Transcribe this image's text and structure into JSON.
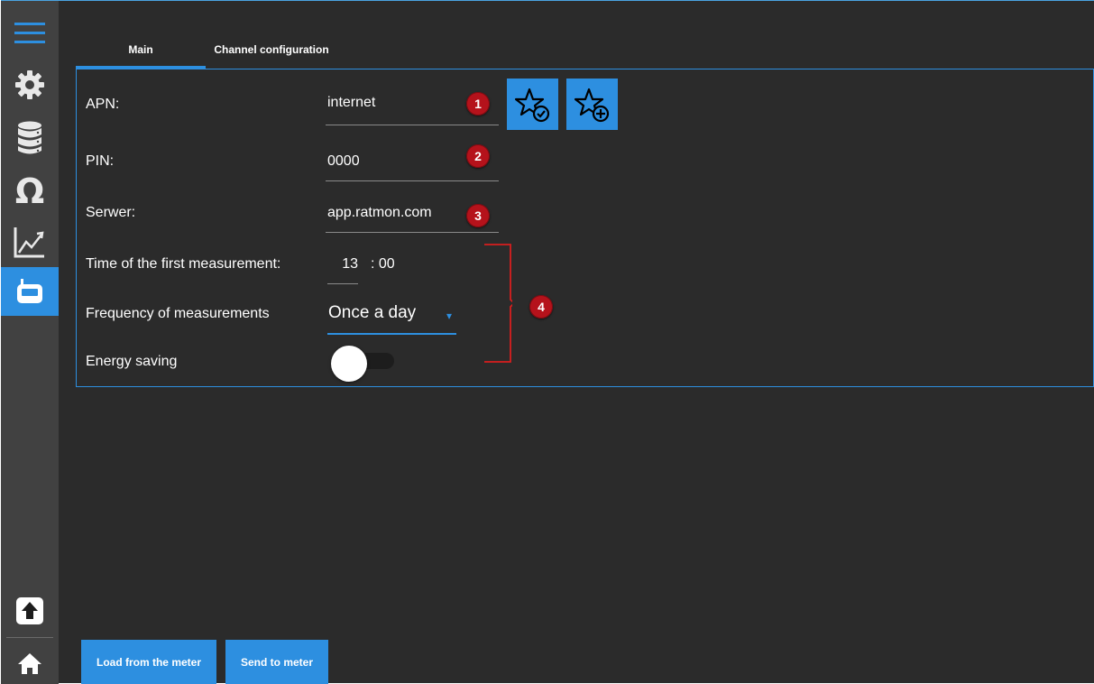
{
  "sidebar": {
    "items": [
      {
        "icon": "hamburger-menu-icon"
      },
      {
        "icon": "gear-icon"
      },
      {
        "icon": "database-icon"
      },
      {
        "icon": "omega-icon"
      },
      {
        "icon": "line-chart-icon"
      },
      {
        "icon": "meter-device-icon",
        "active": true
      },
      {
        "icon": "upload-icon"
      },
      {
        "icon": "home-icon"
      }
    ],
    "accent_color": "#2d8fe0"
  },
  "tabs": [
    {
      "label": "Main",
      "active": true
    },
    {
      "label": "Channel configuration",
      "active": false
    }
  ],
  "form": {
    "apn": {
      "label": "APN:",
      "value": "internet",
      "badge": "1"
    },
    "pin": {
      "label": "PIN:",
      "value": "0000",
      "badge": "2"
    },
    "server": {
      "label": "Serwer:",
      "value": "app.ratmon.com",
      "badge": "3"
    },
    "first_measurement": {
      "label": "Time of the first measurement:",
      "hour": "13",
      "minute": ": 00"
    },
    "frequency": {
      "label": "Frequency of measurements",
      "value": "Once a day",
      "arrow": "▾"
    },
    "energy_saving": {
      "label": "Energy saving",
      "enabled": false
    },
    "group_badge": "4"
  },
  "favorites": {
    "apply_icon": "star-check-icon",
    "add_icon": "star-plus-icon"
  },
  "buttons": {
    "load": "Load from the meter",
    "send": "Send to meter"
  },
  "colors": {
    "background": "#2b2b2b",
    "sidebar": "#414141",
    "accent": "#2d8fe0",
    "badge": "#b5121b"
  }
}
